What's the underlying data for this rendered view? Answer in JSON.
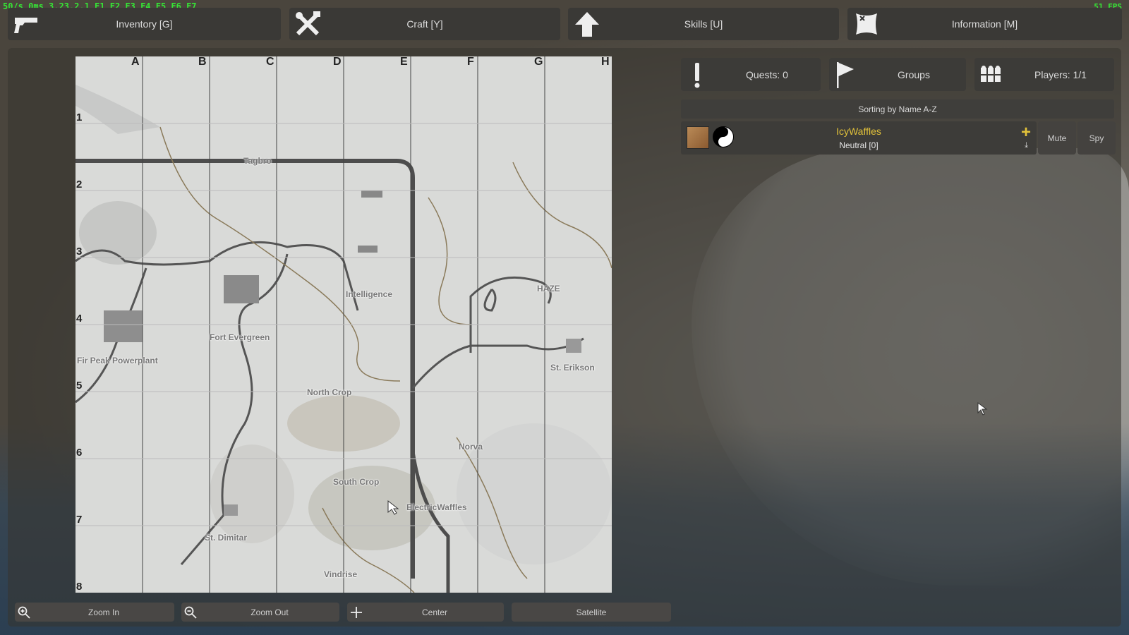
{
  "hud": {
    "debug": "50/s 0ms 3.23.2.1 F1 F2 F3 F4 F5 F6 F7",
    "fps": "51 FPS"
  },
  "topbar": [
    {
      "label": "Inventory [G]",
      "icon": "pistol-icon"
    },
    {
      "label": "Craft [Y]",
      "icon": "crossed-tools-icon"
    },
    {
      "label": "Skills [U]",
      "icon": "arrow-up-icon"
    },
    {
      "label": "Information [M]",
      "icon": "scroll-map-icon"
    }
  ],
  "map": {
    "columns": [
      "A",
      "B",
      "C",
      "D",
      "E",
      "F",
      "G",
      "H"
    ],
    "rows": [
      "1",
      "2",
      "3",
      "4",
      "5",
      "6",
      "7",
      "8"
    ],
    "places": [
      "Tagbro",
      "Intelligence",
      "HAZE",
      "Fort Evergreen",
      "Fir Peak Powerplant",
      "St. Erikson",
      "North Crop",
      "Norva",
      "South Crop",
      "ElectricWaffles",
      "St. Dimitar",
      "Vindrise"
    ]
  },
  "map_controls": {
    "zoom_in": "Zoom In",
    "zoom_out": "Zoom Out",
    "center": "Center",
    "satellite": "Satellite"
  },
  "right": {
    "quests": "Quests: 0",
    "groups": "Groups",
    "players": "Players: 1/1",
    "sorting": "Sorting by Name A-Z",
    "player": {
      "name": "IcyWaffles",
      "status": "Neutral [0]"
    },
    "mute": "Mute",
    "spy": "Spy"
  },
  "colors": {
    "accent_yellow": "#e2c23a",
    "hud_green": "#35e635",
    "button_bg": "#3a3936"
  }
}
